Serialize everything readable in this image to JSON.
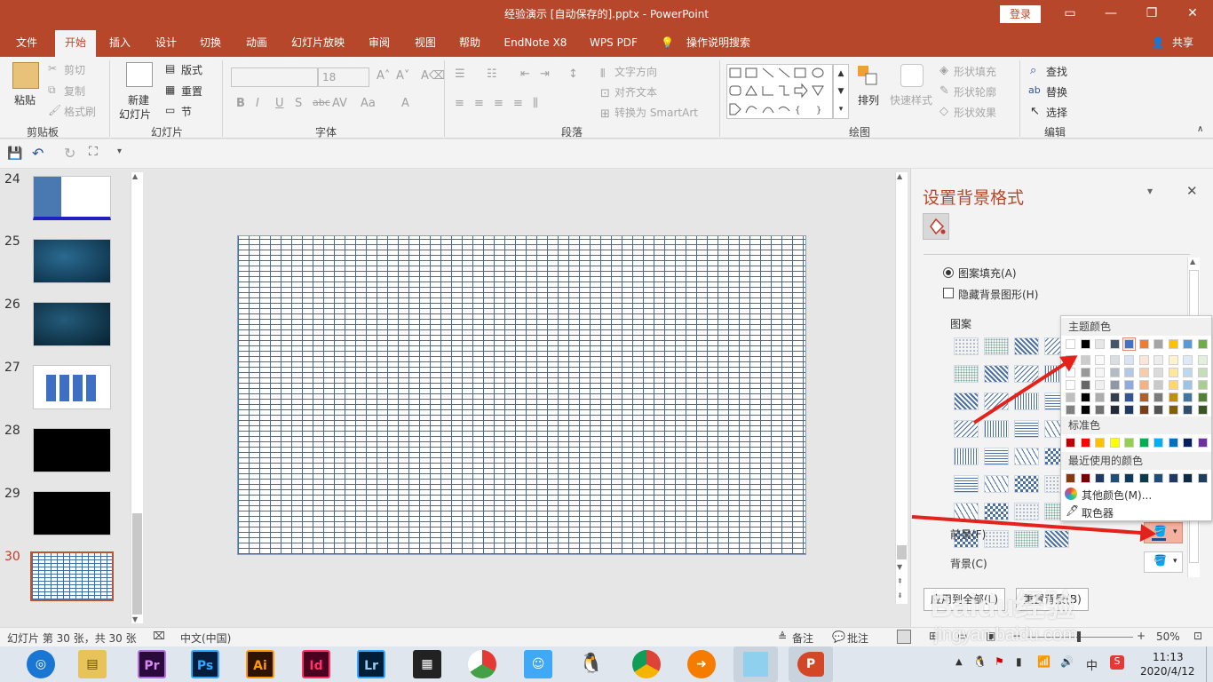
{
  "window": {
    "title": "经验演示 [自动保存的].pptx - PowerPoint",
    "login_label": "登录",
    "share_label": "共享"
  },
  "tabs": [
    "文件",
    "开始",
    "插入",
    "设计",
    "切换",
    "动画",
    "幻灯片放映",
    "审阅",
    "视图",
    "帮助",
    "EndNote X8",
    "WPS PDF",
    "操作说明搜索"
  ],
  "ribbon": {
    "clipboard": {
      "label": "剪贴板",
      "paste": "粘贴",
      "cut": "剪切",
      "copy": "复制",
      "format_painter": "格式刷"
    },
    "slides": {
      "label": "幻灯片",
      "new_slide_1": "新建",
      "new_slide_2": "幻灯片",
      "layout": "版式",
      "reset": "重置",
      "section": "节"
    },
    "font": {
      "label": "字体",
      "size": "18"
    },
    "paragraph": {
      "label": "段落",
      "text_direction": "文字方向",
      "align_text": "对齐文本",
      "smartart": "转换为 SmartArt"
    },
    "drawing": {
      "label": "绘图",
      "arrange": "排列",
      "quick_styles": "快速样式",
      "shape_fill": "形状填充",
      "shape_outline": "形状轮廓",
      "shape_effects": "形状效果"
    },
    "editing": {
      "label": "编辑",
      "find": "查找",
      "replace": "替换",
      "select": "选择"
    }
  },
  "slides": {
    "numbers": [
      "24",
      "25",
      "26",
      "27",
      "28",
      "29",
      "30"
    ],
    "current": "30"
  },
  "pane": {
    "title": "设置背景格式",
    "pattern_fill": "图案填充(A)",
    "hide_bg_graphics": "隐藏背景图形(H)",
    "pattern_label": "图案",
    "foreground": "前景(F)",
    "background": "背景(C)",
    "apply_all": "应用到全部(L)",
    "reset_bg": "重置背景(B)"
  },
  "color_popup": {
    "theme_colors": "主题颜色",
    "standard_colors": "标准色",
    "recent_colors": "最近使用的颜色",
    "more_colors": "其他颜色(M)...",
    "eyedropper": "取色器",
    "theme_top": [
      "#ffffff",
      "#000000",
      "#e7e6e6",
      "#44546a",
      "#4472c4",
      "#ed7d31",
      "#a5a5a5",
      "#ffc000",
      "#5b9bd5",
      "#70ad47"
    ],
    "standard": [
      "#c00000",
      "#ff0000",
      "#ffc000",
      "#ffff00",
      "#92d050",
      "#00b050",
      "#00b0f0",
      "#0070c0",
      "#002060",
      "#7030a0"
    ],
    "recent": [
      "#843c0c",
      "#7b0000",
      "#1f3864",
      "#1f4e79",
      "#0e3a5b",
      "#0b3a4a",
      "#1f4e79",
      "#203864",
      "#0e2a47",
      "#1c3f5e"
    ]
  },
  "status": {
    "slide_info": "幻灯片 第 30 张，共 30 张",
    "language": "中文(中国)",
    "notes": "备注",
    "comments": "批注",
    "zoom": "50%"
  },
  "taskbar": {
    "time": "11:13",
    "date": "2020/4/12",
    "ime": "中",
    "apps": [
      "Pr",
      "Ps",
      "Ai",
      "Id",
      "Lr"
    ]
  },
  "watermark": {
    "text": "Baidu经验",
    "url": "jingyan.baidu.com"
  }
}
